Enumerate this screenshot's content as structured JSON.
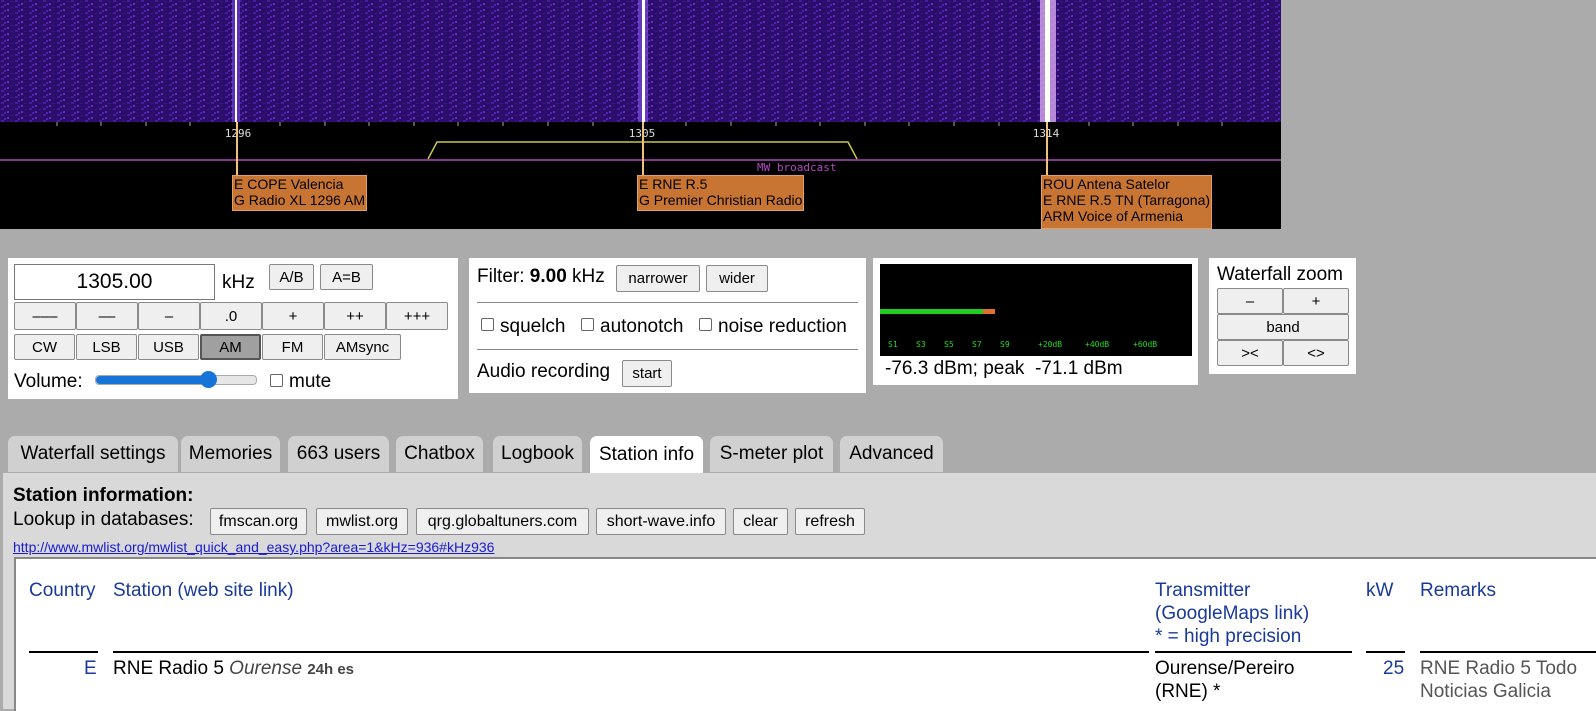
{
  "spectrum": {
    "ticks": [
      "1296",
      "1305",
      "1314"
    ],
    "band_label": "MW broadcast",
    "stations": [
      {
        "lines": [
          "E COPE Valencia",
          "G Radio XL 1296 AM"
        ]
      },
      {
        "lines": [
          "E RNE R.5",
          "G Premier Christian Radio"
        ]
      },
      {
        "lines": [
          "ROU Antena Satelor",
          "E RNE R.5 TN (Tarragona)",
          "ARM Voice of Armenia"
        ]
      }
    ],
    "colors": {
      "waterfall_bg": "#2a0e6a",
      "passband": "#c8c84a",
      "band_line": "#b04ac0",
      "station_box": "#c87533"
    }
  },
  "tuning": {
    "frequency_value": "1305.00",
    "unit": "kHz",
    "ab_label": "A/B",
    "aeqb_label": "A=B",
    "step_buttons": [
      "–––",
      "––",
      "–",
      ".0",
      "+",
      "++",
      "+++"
    ],
    "modes": [
      "CW",
      "LSB",
      "USB",
      "AM",
      "FM",
      "AMsync"
    ],
    "selected_mode": "AM",
    "volume_label": "Volume:",
    "volume_level": 0.7,
    "mute_label": "mute"
  },
  "filter": {
    "label": "Filter:",
    "value": "9.00",
    "unit": "kHz",
    "narrower_label": "narrower",
    "wider_label": "wider",
    "squelch_label": "squelch",
    "autonotch_label": "autonotch",
    "noise_reduction_label": "noise reduction",
    "recording_label": "Audio recording",
    "start_label": "start"
  },
  "smeter": {
    "scale_labels": [
      "S1",
      "S3",
      "S5",
      "S7",
      "S9",
      "+20dB",
      "+40dB",
      "+60dB"
    ],
    "reading": "-76.3 dBm; peak  -71.1 dBm",
    "level_fraction": 0.37,
    "colors": {
      "bar": "#22cc22",
      "peak": "#e07030",
      "labels": "#22dd22"
    }
  },
  "zoom": {
    "title": "Waterfall zoom",
    "minus_label": "–",
    "plus_label": "+",
    "band_label": "band",
    "narrow_label": "><",
    "wide_label": "<>"
  },
  "tabs": [
    "Waterfall settings",
    "Memories",
    "663 users",
    "Chatbox",
    "Logbook",
    "Station info",
    "S-meter plot",
    "Advanced"
  ],
  "active_tab": "Station info",
  "station_info": {
    "title": "Station information:",
    "lookup_label": "Lookup in databases:",
    "buttons": [
      "fmscan.org",
      "mwlist.org",
      "qrg.globaltuners.com",
      "short-wave.info",
      "clear",
      "refresh"
    ],
    "link": "http://www.mwlist.org/mwlist_quick_and_easy.php?area=1&kHz=936#kHz936",
    "table": {
      "headers": {
        "country": "Country",
        "station": "Station (web site link)",
        "transmitter": [
          "Transmitter",
          "(GoogleMaps link)",
          "* = high precision"
        ],
        "kw": "kW",
        "remarks": "Remarks"
      },
      "rows": [
        {
          "country": "E",
          "station": "RNE Radio 5",
          "location": "Ourense",
          "schedule": "24h es",
          "transmitter": [
            "Ourense/Pereiro",
            "(RNE) *"
          ],
          "kw": "25",
          "remarks": [
            "RNE Radio 5 Todo",
            "Noticias Galicia"
          ]
        }
      ]
    }
  }
}
